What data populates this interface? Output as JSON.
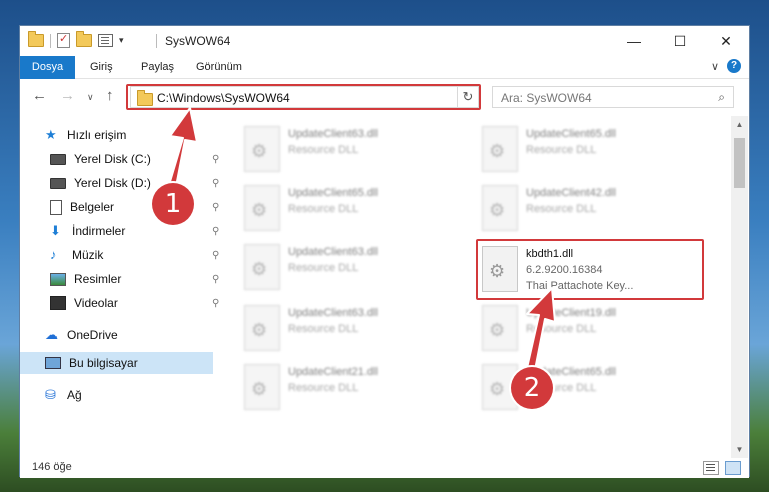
{
  "window": {
    "title": "SysWOW64",
    "controls": {
      "minimize": "—",
      "maximize": "☐",
      "close": "✕"
    }
  },
  "ribbon": {
    "tabs": [
      "Dosya",
      "Giriş",
      "Paylaş",
      "Görünüm"
    ],
    "help": "?"
  },
  "navbar": {
    "back": "←",
    "forward": "→",
    "recent": "∨",
    "up": "↑",
    "address": "C:\\Windows\\SysWOW64",
    "refresh": "↻",
    "search_placeholder": "Ara: SysWOW64",
    "search_icon": "⌕"
  },
  "sidebar": {
    "items": [
      {
        "label": "Hızlı erişim",
        "icon": "star-icon",
        "glyph": "★"
      },
      {
        "label": "Yerel Disk (C:)",
        "icon": "drive-icon",
        "pinned": true
      },
      {
        "label": "Yerel Disk (D:)",
        "icon": "drive-icon",
        "pinned": true
      },
      {
        "label": "Belgeler",
        "icon": "documents-icon",
        "pinned": true
      },
      {
        "label": "İndirmeler",
        "icon": "downloads-icon",
        "glyph": "⬇",
        "pinned": true
      },
      {
        "label": "Müzik",
        "icon": "music-icon",
        "glyph": "♪",
        "pinned": true
      },
      {
        "label": "Resimler",
        "icon": "pictures-icon",
        "pinned": true
      },
      {
        "label": "Videolar",
        "icon": "videos-icon",
        "pinned": true
      },
      {
        "label": "OneDrive",
        "icon": "cloud-icon",
        "glyph": "☁"
      },
      {
        "label": "Bu bilgisayar",
        "icon": "computer-icon",
        "selected": true
      },
      {
        "label": "Ağ",
        "icon": "network-icon",
        "glyph": "⛁"
      }
    ],
    "pin_glyph": "📌"
  },
  "files": [
    {
      "name": "UpdateClient63.dll",
      "type": "Resource DLL"
    },
    {
      "name": "UpdateClient65.dll",
      "type": "Resource DLL"
    },
    {
      "name": "UpdateClient65.dll",
      "type": "Resource DLL"
    },
    {
      "name": "UpdateClient42.dll",
      "type": "Resource DLL"
    },
    {
      "name": "UpdateClient63.dll",
      "type": "Resource DLL"
    },
    {
      "name": "kbdth1.dll",
      "version": "6.2.9200.16384",
      "description": "Thai Pattachote Key..."
    },
    {
      "name": "UpdateClient63.dll",
      "type": "Resource DLL"
    },
    {
      "name": "UpdateClient19.dll",
      "type": "Resource DLL"
    },
    {
      "name": "UpdateClient21.dll",
      "type": "Resource DLL"
    },
    {
      "name": "UpdateClient65.dll",
      "type": "Resource DLL"
    }
  ],
  "status": {
    "count": "146 öğe"
  },
  "annotations": {
    "step1": "1",
    "step2": "2",
    "color": "#d2393b"
  }
}
